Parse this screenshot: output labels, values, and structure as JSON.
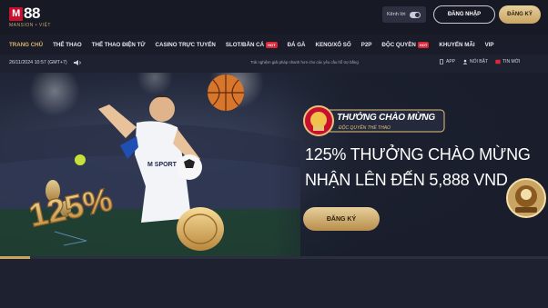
{
  "header": {
    "logo_text": "88",
    "logo_mark": "M",
    "logo_sub": "MANSION • VIỆT",
    "voice_label": "Kênh lời",
    "login_label": "ĐĂNG NHẬP",
    "register_label": "ĐĂNG KÝ"
  },
  "nav": {
    "items": [
      {
        "label": "TRANG CHỦ",
        "active": true
      },
      {
        "label": "THỂ THAO"
      },
      {
        "label": "THỂ THAO ĐIỆN TỬ"
      },
      {
        "label": "CASINO TRỰC TUYẾN"
      },
      {
        "label": "SLOT/BẮN CÁ",
        "badge": "HOT"
      },
      {
        "label": "ĐÁ GÀ"
      },
      {
        "label": "KENO/XỔ SỐ"
      },
      {
        "label": "P2P"
      },
      {
        "label": "ĐỘC QUYỀN",
        "badge": "HOT"
      },
      {
        "label": "KHUYẾN MÃI"
      },
      {
        "label": "VIP"
      }
    ]
  },
  "ticker": {
    "datetime": "26/11/2024 10:57 (GMT+7)",
    "message": "Trải nghiệm giải pháp nhanh hơn cho các yêu cầu hỗ trợ bằng ",
    "links": [
      {
        "label": "APP",
        "icon": "phone-icon"
      },
      {
        "label": "NỔI BẬT",
        "icon": "user-icon"
      },
      {
        "label": "TIN MỚI",
        "icon": "news-icon"
      }
    ]
  },
  "banner": {
    "badge_value": "125%",
    "jersey_text": "M SPORT",
    "promo_title": "THƯỞNG CHÀO MỪNG",
    "promo_subtitle": "ĐỘC QUYỀN THỂ THAO",
    "headline_line1": "125% THƯỞNG CHÀO MỪNG",
    "headline_line2": "NHẬN LÊN ĐẾN 5,888 VND",
    "cta_label": "ĐĂNG KÝ",
    "slide_progress": 0.055
  },
  "colors": {
    "accent_gold": "#c9a463",
    "brand_red": "#c8102e",
    "background": "#1e2130"
  }
}
